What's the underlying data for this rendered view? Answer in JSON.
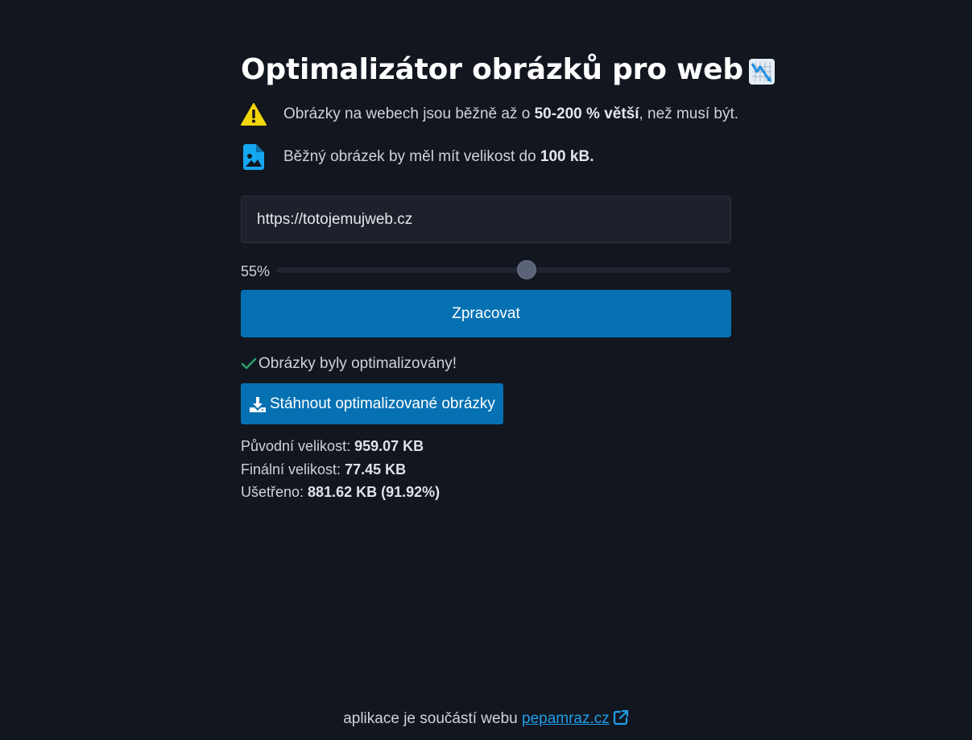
{
  "app": {
    "title": "Optimalizátor obrázků pro web",
    "title_icon": "chart-decreasing-icon"
  },
  "info": [
    {
      "icon": "warning-icon",
      "icon_color": "#f2d50a",
      "text_before": "Obrázky na webech jsou běžně až o ",
      "text_bold": "50-200 % větší",
      "text_after": ", než musí být."
    },
    {
      "icon": "file-image-icon",
      "icon_color": "#15a7f0",
      "text_before": "Běžný obrázek by měl mít velikost do ",
      "text_bold": "100 kB.",
      "text_after": ""
    }
  ],
  "form": {
    "url_value": "https://totojemujweb.cz",
    "quality_label": "55%",
    "quality_value": 55,
    "submit_label": "Zpracovat"
  },
  "result": {
    "status_icon": "check-icon",
    "status_text": "Obrázky byly optimalizovány!",
    "download_icon": "download-icon",
    "download_label": "Stáhnout optimalizované obrázky",
    "stats": [
      {
        "label": "Původní velikost: ",
        "value": "959.07 KB"
      },
      {
        "label": "Finální velikost: ",
        "value": "77.45 KB"
      },
      {
        "label": "Ušetřeno: ",
        "value": "881.62 KB (91.92%)"
      }
    ]
  },
  "footer": {
    "text": "aplikace je součástí webu ",
    "link_label": "pepamraz.cz",
    "link_icon": "external-link-icon"
  },
  "colors": {
    "background": "#12161f",
    "accent": "#0571b3",
    "link": "#1f9fe8",
    "success": "#2e9e6b"
  }
}
